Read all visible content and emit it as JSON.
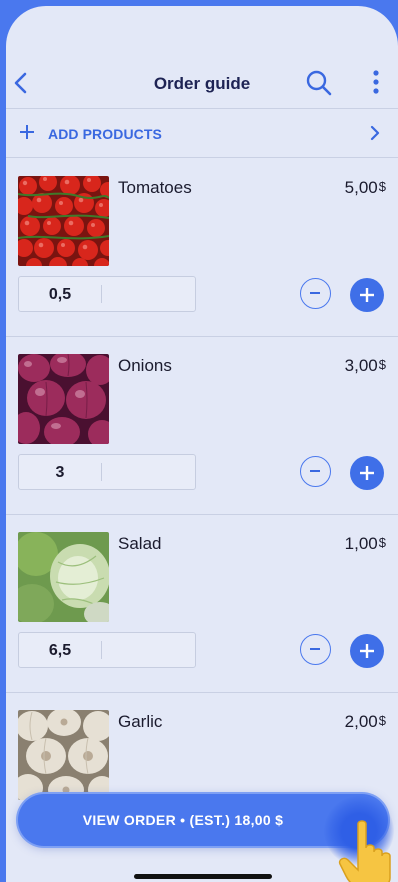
{
  "header": {
    "title": "Order guide",
    "back_icon": "chevron-left-icon",
    "search_icon": "search-icon",
    "more_icon": "more-vertical-icon"
  },
  "add_products": {
    "label": "ADD PRODUCTS",
    "icon": "plus-icon",
    "chevron_icon": "chevron-right-icon"
  },
  "products": [
    {
      "name": "Tomatoes",
      "price": "5,00",
      "currency": "$",
      "quantity": "0,5",
      "image": "tomatoes-image"
    },
    {
      "name": "Onions",
      "price": "3,00",
      "currency": "$",
      "quantity": "3",
      "image": "onions-image"
    },
    {
      "name": "Salad",
      "price": "1,00",
      "currency": "$",
      "quantity": "6,5",
      "image": "salad-image"
    },
    {
      "name": "Garlic",
      "price": "2,00",
      "currency": "$",
      "image": "garlic-image"
    }
  ],
  "footer": {
    "view_order_label": "VIEW ORDER • (EST.) 18,00 $"
  },
  "colors": {
    "accent": "#4a78ee",
    "background": "#e3e8f7",
    "title_text": "#1e2354"
  }
}
